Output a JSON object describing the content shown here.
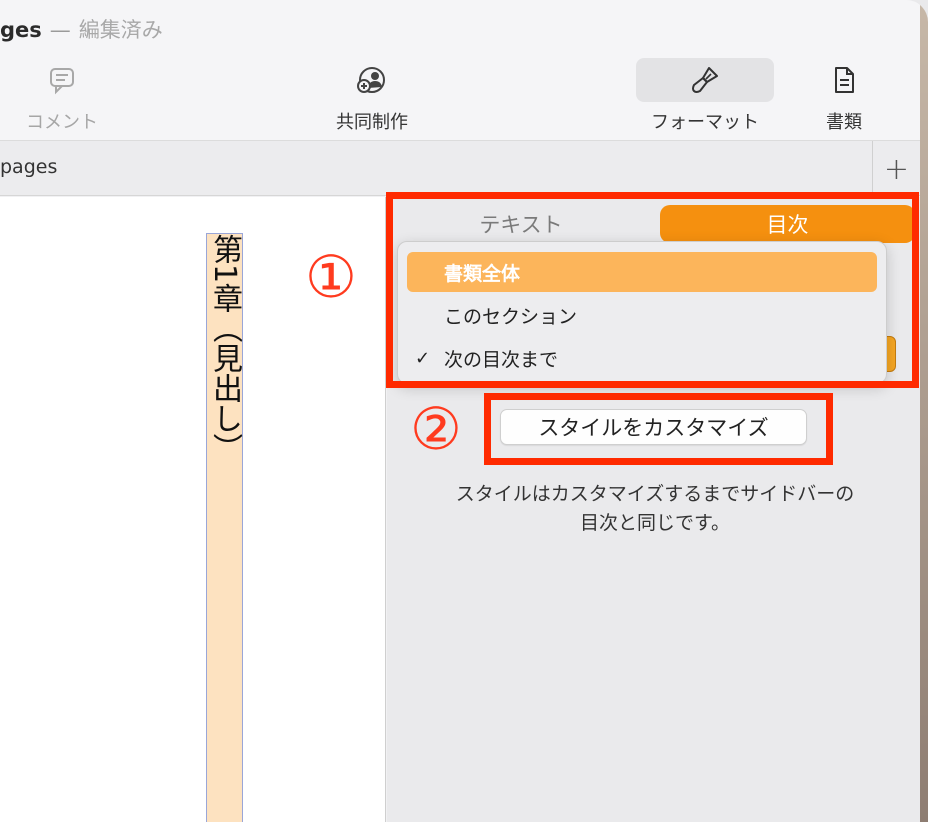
{
  "window": {
    "app_name_fragment": "ges",
    "separator": "—",
    "status": "編集済み"
  },
  "toolbar": {
    "comment_label": "コメント",
    "collaborate_label": "共同制作",
    "format_label": "フォーマット",
    "document_label": "書類"
  },
  "tabbar": {
    "doc_name": "pages",
    "add_label": "+"
  },
  "document": {
    "heading_vertical": "第1章（見出し）"
  },
  "sidebar": {
    "tab_text": "テキスト",
    "tab_toc": "目次",
    "dropdown": {
      "options": [
        {
          "label": "書類全体",
          "highlighted": true,
          "checked": false
        },
        {
          "label": "このセクション",
          "highlighted": false,
          "checked": false
        },
        {
          "label": "次の目次まで",
          "highlighted": false,
          "checked": true
        }
      ],
      "check_glyph": "✓"
    },
    "customize_button": "スタイルをカスタマイズ",
    "description_line1": "スタイルはカスタマイズするまでサイドバーの",
    "description_line2": "目次と同じです。"
  },
  "annotations": {
    "marker1": "①",
    "marker2": "②",
    "color": "#ff2a00"
  },
  "colors": {
    "accent": "#f5900f",
    "highlight": "#fcb55b"
  }
}
